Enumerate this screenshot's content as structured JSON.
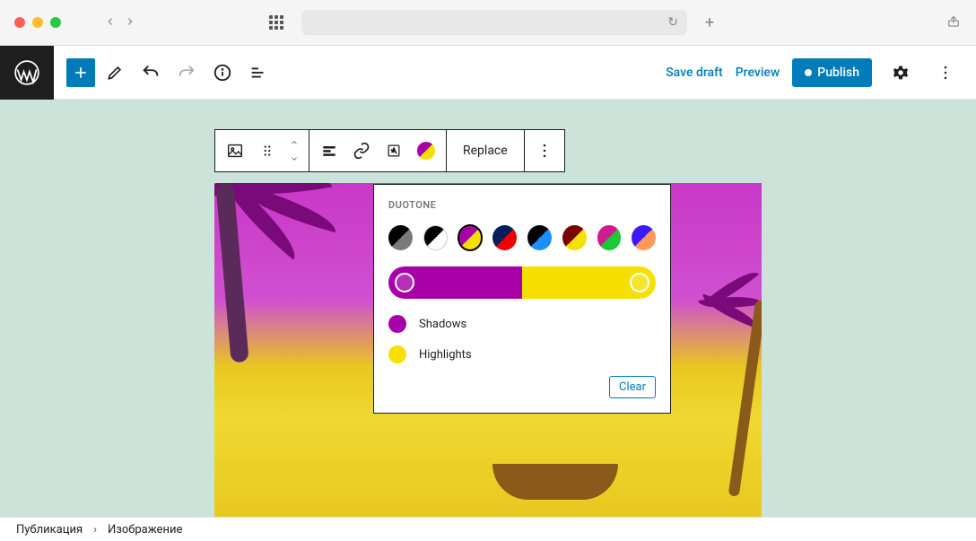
{
  "topbar": {
    "save_draft": "Save draft",
    "preview": "Preview",
    "publish": "Publish"
  },
  "block_toolbar": {
    "replace": "Replace"
  },
  "duotone": {
    "title": "DUOTONE",
    "shadows_label": "Shadows",
    "highlights_label": "Highlights",
    "clear": "Clear",
    "shadow_color": "#a800a8",
    "highlight_color": "#f5e000",
    "presets": [
      {
        "name": "dark-grayscale"
      },
      {
        "name": "grayscale"
      },
      {
        "name": "purple-yellow"
      },
      {
        "name": "blue-red"
      },
      {
        "name": "midnight"
      },
      {
        "name": "magenta-yellow"
      },
      {
        "name": "purple-green"
      },
      {
        "name": "blue-orange"
      }
    ]
  },
  "breadcrumb": {
    "root": "Публикация",
    "current": "Изображение"
  }
}
